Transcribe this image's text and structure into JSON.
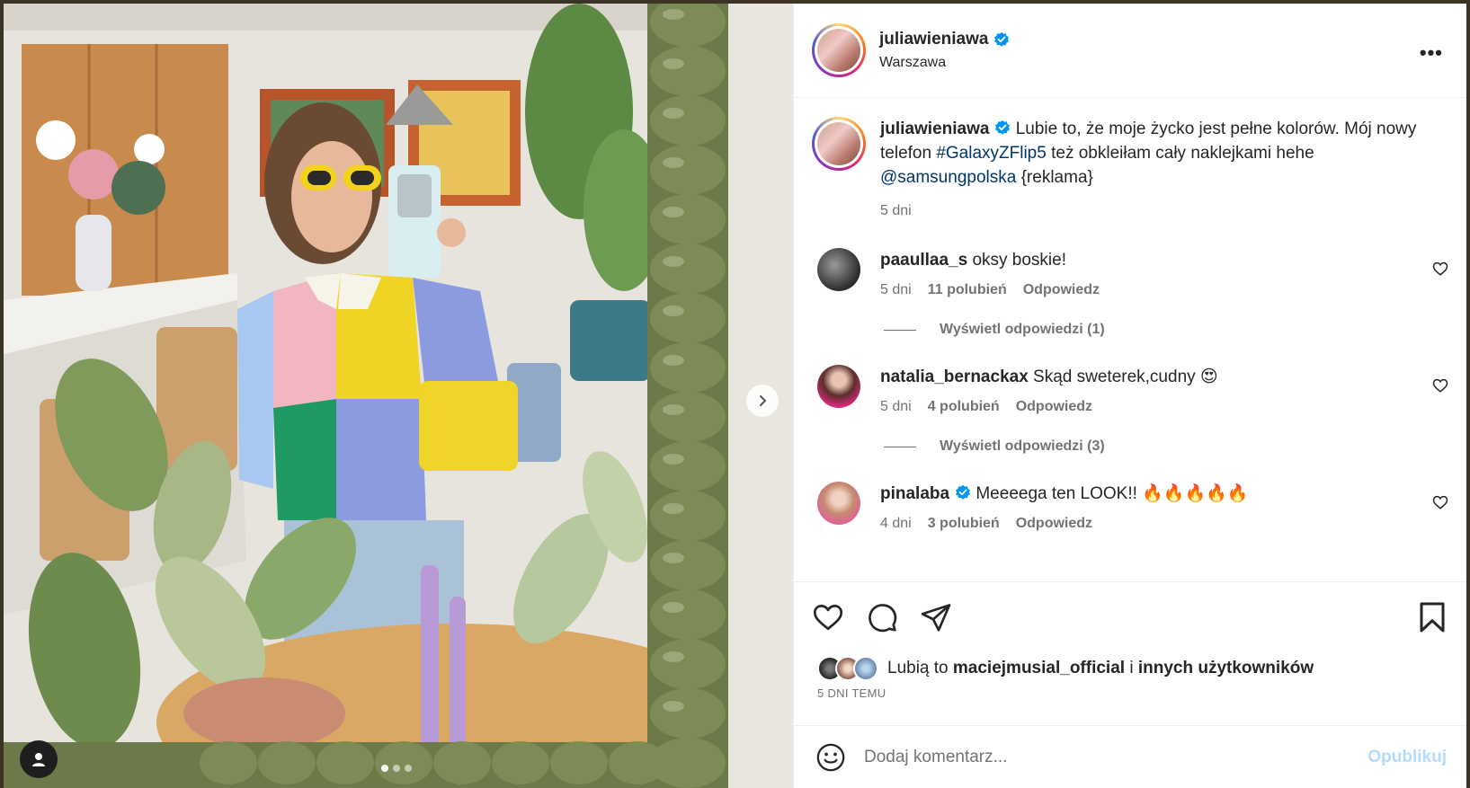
{
  "post": {
    "username": "juliawieniawa",
    "location": "Warszawa",
    "more_label": "•••"
  },
  "caption": {
    "username": "juliawieniawa",
    "text_1": " Lubie to, że moje życko jest pełne kolorów. Mój nowy telefon ",
    "hashtag": "#GalaxyZFlip5",
    "text_2": " też obkleiłam cały naklejkami hehe ",
    "mention": "@samsungpolska",
    "text_3": " {reklama}",
    "time": "5 dni"
  },
  "comments": [
    {
      "username": "paaullaa_s",
      "text": " oksy boskie!",
      "time": "5 dni",
      "likes": "11 polubień",
      "reply": "Odpowiedz",
      "view_replies": "Wyświetl odpowiedzi (1)"
    },
    {
      "username": "natalia_bernackax",
      "text": " Skąd sweterek,cudny 😍",
      "time": "5 dni",
      "likes": "4 polubień",
      "reply": "Odpowiedz",
      "view_replies": "Wyświetl odpowiedzi (3)"
    },
    {
      "username": "pinalaba",
      "text": " Meeeega ten LOOK!! 🔥🔥🔥🔥🔥",
      "time": "4 dni",
      "likes": "3 polubień",
      "reply": "Odpowiedz"
    }
  ],
  "likes": {
    "prefix": "Lubią to ",
    "user": "maciejmusial_official",
    "middle": " i ",
    "others": "innych użytkowników"
  },
  "date": "5 DNI TEMU",
  "add_comment": {
    "placeholder": "Dodaj komentarz...",
    "post_label": "Opublikuj"
  },
  "carousel": {
    "count": 3,
    "active_index": 0
  },
  "colors": {
    "link": "#00376b",
    "verified": "#0095f6",
    "muted": "#737373",
    "post_disabled": "#b3dbff"
  },
  "icons": [
    "more-icon",
    "verified-icon",
    "heart-icon",
    "comment-icon",
    "share-icon",
    "bookmark-icon",
    "emoji-icon",
    "chevron-right-icon",
    "user-tag-icon"
  ]
}
